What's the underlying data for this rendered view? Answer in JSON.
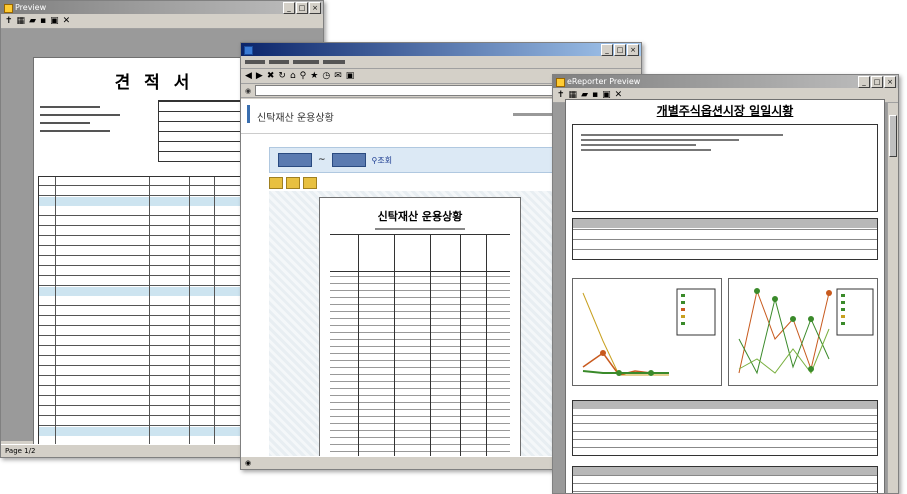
{
  "window1": {
    "title": "Preview",
    "toolbar_icons": [
      "pin-icon",
      "print-setup-icon",
      "open-icon",
      "save-icon",
      "print-icon",
      "close-icon"
    ],
    "doc_title": "견 적 서",
    "status": "Page 1/2"
  },
  "window2": {
    "title": "",
    "doc_title": "신탁재산 운용상황",
    "filter_separator": "~",
    "search_label": "조회"
  },
  "window3": {
    "title": "eReporter Preview",
    "doc_title": "개별주식옵션시장 일일시황"
  },
  "colors": {
    "titlebar_active": "#0a246a",
    "chrome": "#d4d0c8",
    "ie_blue": "#dce9f5",
    "chart_green": "#3a8a2a",
    "chart_orange": "#c85a1e"
  }
}
